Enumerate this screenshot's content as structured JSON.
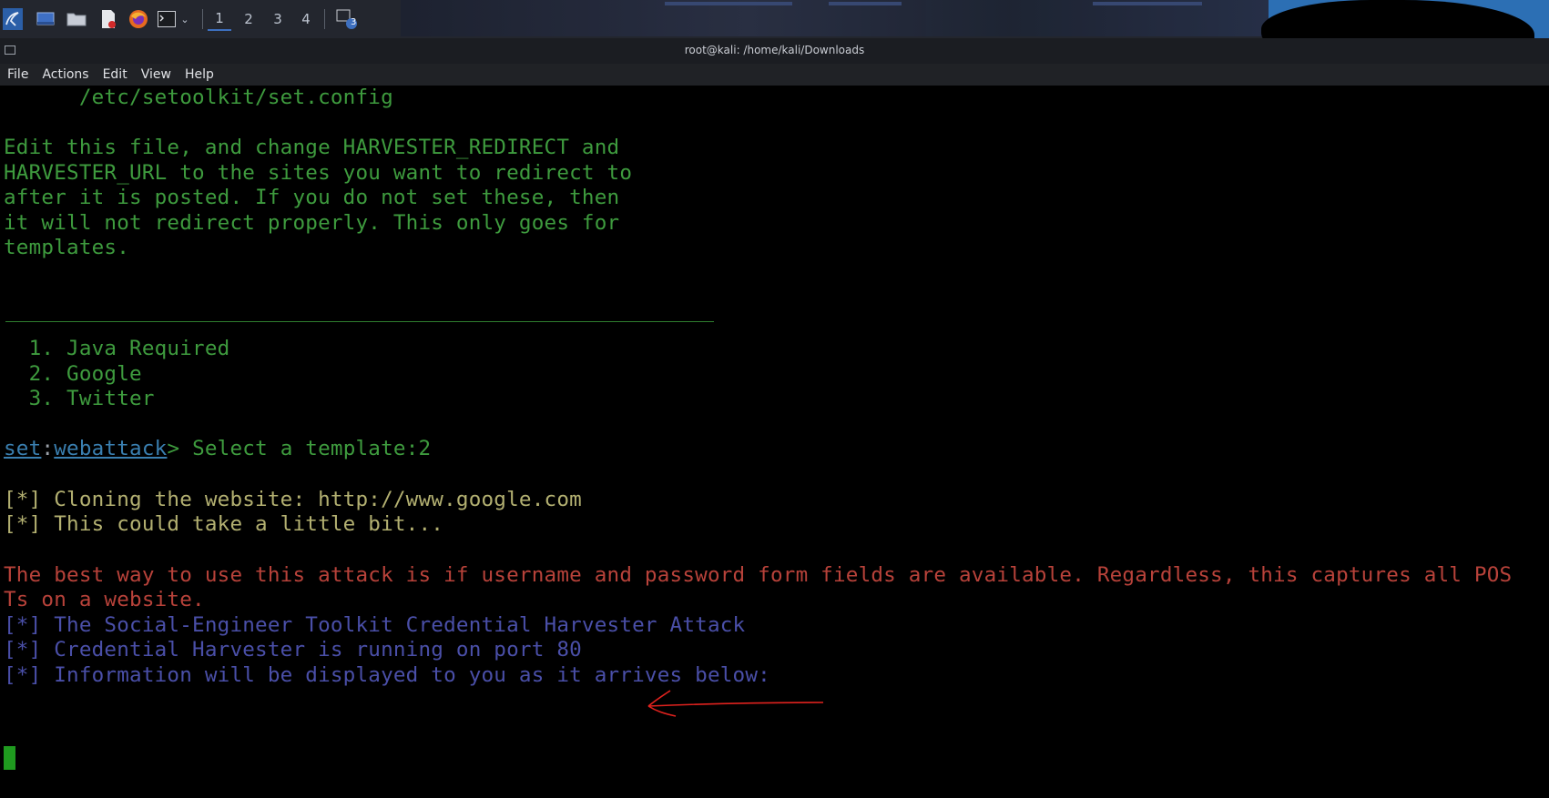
{
  "taskbar": {
    "workspaces": [
      "1",
      "2",
      "3",
      "4"
    ],
    "active_workspace": "1",
    "notification_badge": "3",
    "icons": [
      "kali-menu-icon",
      "desktop-icon",
      "file-manager-icon",
      "text-editor-icon",
      "firefox-icon",
      "terminal-icon",
      "dropdown-chevron-icon",
      "notification-icon"
    ]
  },
  "window": {
    "title": "root@kali: /home/kali/Downloads"
  },
  "menubar": {
    "items": [
      "File",
      "Actions",
      "Edit",
      "View",
      "Help"
    ]
  },
  "terminal": {
    "config_path": "      /etc/setoolkit/set.config",
    "info_lines": [
      "Edit this file, and change HARVESTER_REDIRECT and",
      "HARVESTER_URL to the sites you want to redirect to",
      "after it is posted. If you do not set these, then",
      "it will not redirect properly. This only goes for",
      "templates."
    ],
    "options": [
      "  1. Java Required",
      "  2. Google",
      "  3. Twitter"
    ],
    "prompt": {
      "set": "set",
      "colon": ":",
      "module": "webattack",
      "text": "> Select a template:2"
    },
    "cloning_lines": [
      "[*] Cloning the website: http://www.google.com",
      "[*] This could take a little bit..."
    ],
    "warning_lines": [
      "The best way to use this attack is if username and password form fields are available. Regardless, this captures all POS",
      "Ts on a website."
    ],
    "status_lines": [
      "[*] The Social-Engineer Toolkit Credential Harvester Attack",
      "[*] Credential Harvester is running on port 80",
      "[*] Information will be displayed to you as it arrives below:"
    ],
    "colors": {
      "green": "#3e9b3e",
      "yellow": "#b3b071",
      "red": "#b8423a",
      "blue": "#4a4fa8",
      "annotation_arrow": "#e0221e"
    }
  }
}
